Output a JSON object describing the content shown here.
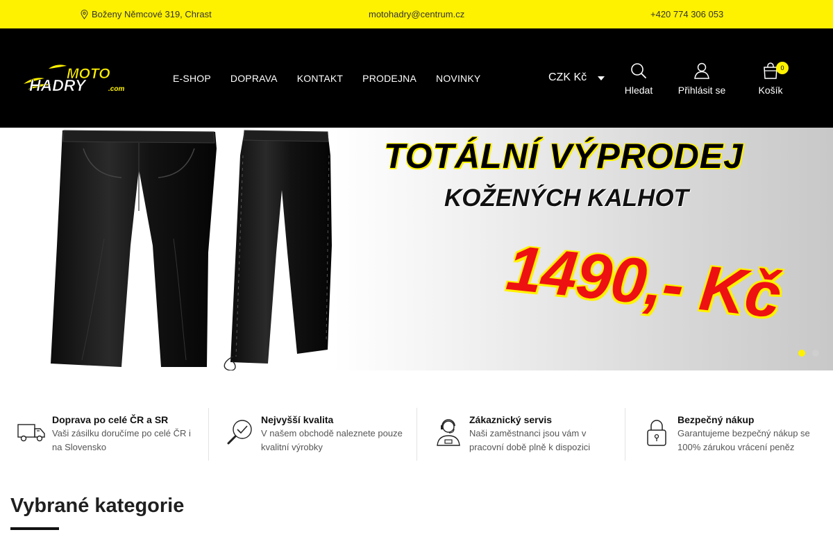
{
  "topbar": {
    "address": "Boženy Němcové 319, Chrast",
    "email": "motohadry@centrum.cz",
    "phone": "+420 774 306 053"
  },
  "logo": {
    "line1": "MOTO",
    "line2": "HADRY",
    "suffix": ".com"
  },
  "nav": [
    "E-SHOP",
    "DOPRAVA",
    "KONTAKT",
    "PRODEJNA",
    "NOVINKY"
  ],
  "header": {
    "currency": "CZK Kč",
    "search_label": "Hledat",
    "login_label": "Přihlásit se",
    "cart_label": "Košík",
    "cart_count": "0"
  },
  "banner": {
    "headline": "TOTÁLNÍ VÝPRODEJ",
    "subline": "KOŽENÝCH KALHOT",
    "price": "1490,- Kč",
    "slides": 2,
    "active_slide": 1
  },
  "features": [
    {
      "title": "Doprava po celé ČR a SR",
      "desc": "Vaši zásilku doručíme po celé ČR i na Slovensko",
      "icon": "truck-icon"
    },
    {
      "title": "Nejvyšší kvalita",
      "desc": "V našem obchodě naleznete pouze kvalitní výrobky",
      "icon": "quality-magnifier-icon"
    },
    {
      "title": "Zákaznický servis",
      "desc": "Naši zaměstnanci jsou vám v pracovní době plně k dispozici",
      "icon": "support-agent-icon"
    },
    {
      "title": "Bezpečný nákup",
      "desc": "Garantujeme bezpečný nákup se 100% zárukou vrácení peněz",
      "icon": "padlock-icon"
    }
  ],
  "section": {
    "title": "Vybrané kategorie"
  },
  "colors": {
    "accent": "#fff200",
    "header_bg": "#000000",
    "price_red": "#ee1111"
  }
}
